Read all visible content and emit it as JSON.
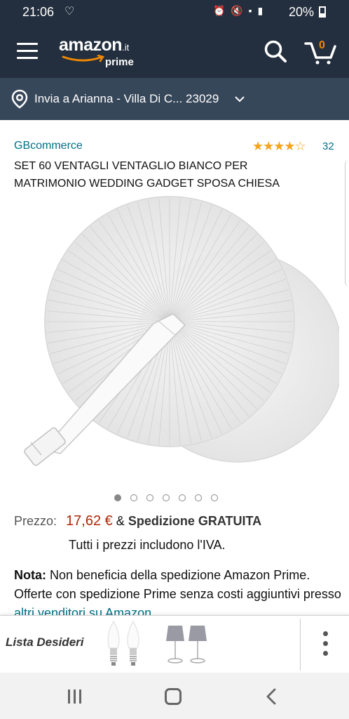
{
  "status_bar": {
    "time": "21:06",
    "battery_text": "20%",
    "icons": [
      "heart-outline-icon",
      "alarm-icon",
      "mute-icon",
      "volte-icon",
      "4g-icon",
      "signal-icon",
      "battery-icon"
    ]
  },
  "header": {
    "logo_text": "amazon",
    "logo_tld": ".it",
    "logo_sub": "prime",
    "cart_count": "0",
    "accent_color": "#f08804",
    "background_color": "#232f3e"
  },
  "address": {
    "text": "Invia a Arianna - Villa Di C... 23029"
  },
  "product": {
    "seller": "GBcommerce",
    "rating_stars": 4.5,
    "rating_count": "32",
    "title": "SET 60 VENTAGLI VENTAGLIO BIANCO PER MATRIMONIO WEDDING GADGET SPOSA CHIESA",
    "image_count": 7,
    "active_image": 1
  },
  "price": {
    "label": "Prezzo:",
    "value": "17,62 €",
    "amp": "&",
    "shipping": "Spedizione GRATUITA",
    "vat_note": "Tutti i prezzi includono l'IVA.",
    "price_color": "#b12704"
  },
  "note": {
    "label": "Nota:",
    "text": "Non beneficia della spedizione Amazon Prime. Offerte con spedizione Prime senza costi aggiuntivi presso",
    "link": "altri venditori su Amazon"
  },
  "wishlist": {
    "title": "Lista Desideri"
  },
  "navigation": {
    "icons": [
      "recent-apps-icon",
      "home-icon",
      "back-icon"
    ]
  }
}
